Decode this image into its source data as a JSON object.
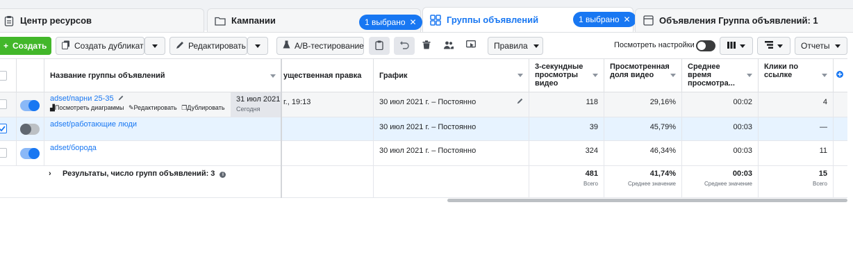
{
  "tabs": {
    "resources": "Центр ресурсов",
    "campaigns": "Кампании",
    "campaigns_badge": "1 выбрано",
    "adsets": "Группы объявлений",
    "adsets_badge": "1 выбрано",
    "ads": "Объявления Группа объявлений: 1"
  },
  "toolbar": {
    "create": "Создать",
    "duplicate": "Создать дубликат",
    "edit": "Редактировать",
    "ab_test": "A/B-тестирование",
    "rules": "Правила",
    "view_settings": "Посмотреть настройки",
    "reports": "Отчеты"
  },
  "columns": {
    "name": "Название группы объявлений",
    "major_edit": "ущественная правка",
    "schedule": "График",
    "views3s": "3-секундные просмотры видео",
    "view_share": "Просмотренная доля видео",
    "avg_time": "Среднее время просмотра...",
    "link_clicks": "Клики по ссылке"
  },
  "rows": [
    {
      "name": "adset/парни 25-35",
      "actions": [
        "Посмотреть диаграммы",
        "Редактировать",
        "Дублировать"
      ],
      "major_edit": "г., 19:13",
      "edit_date": "31 июл 2021",
      "edit_sub": "Сегодня",
      "schedule": "30 июл 2021 г. – Постоянно",
      "views3s": "118",
      "view_share": "29,16%",
      "avg_time": "00:02",
      "link_clicks": "4",
      "active": true,
      "checked": false
    },
    {
      "name": "adset/работающие люди",
      "schedule": "30 июл 2021 г. – Постоянно",
      "views3s": "39",
      "view_share": "45,79%",
      "avg_time": "00:03",
      "link_clicks": "—",
      "active": false,
      "checked": true
    },
    {
      "name": "adset/борода",
      "schedule": "30 июл 2021 г. – Постоянно",
      "views3s": "324",
      "view_share": "46,34%",
      "avg_time": "00:03",
      "link_clicks": "11",
      "active": true,
      "checked": false
    }
  ],
  "summary": {
    "label": "Результаты, число групп объявлений: 3",
    "views3s": "481",
    "views3s_sub": "Всего",
    "view_share": "41,74%",
    "view_share_sub": "Среднее значение",
    "avg_time": "00:03",
    "avg_time_sub": "Среднее значение",
    "link_clicks": "15",
    "link_clicks_sub": "Всего"
  },
  "colors": {
    "accent": "#1877f2",
    "create": "#42b72a"
  }
}
